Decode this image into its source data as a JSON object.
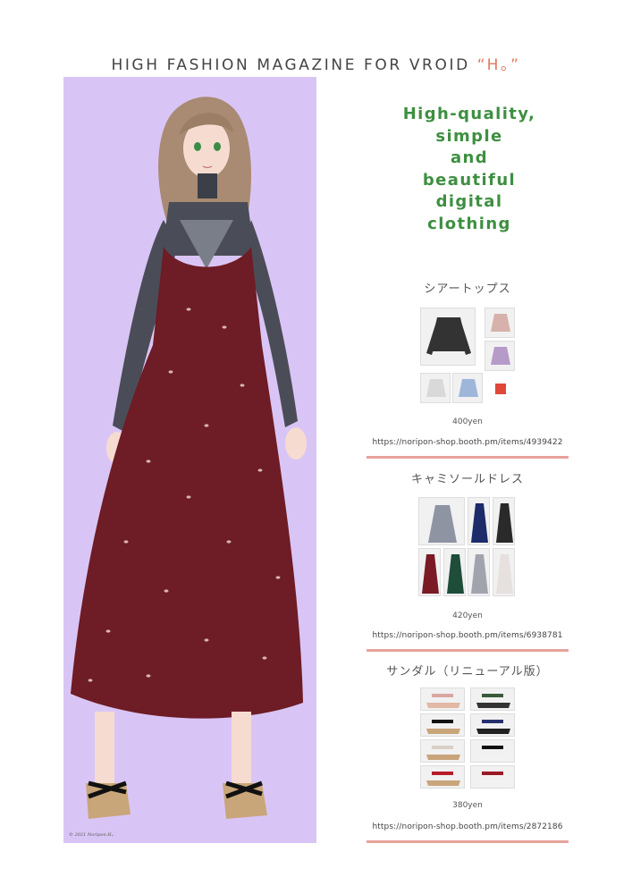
{
  "masthead": {
    "title": "HIGH FASHION MAGAZINE FOR VROID",
    "brand": "“H。”"
  },
  "hero": {
    "copyright": "© 2021 Noripon.H。"
  },
  "tagline": {
    "lines": [
      "High-quality,",
      "simple",
      "and",
      "beautiful",
      "digital",
      "clothing"
    ]
  },
  "products": [
    {
      "title": "シアートップス",
      "price": "400yen",
      "url": "https://noripon-shop.booth.pm/items/4939422"
    },
    {
      "title": "キャミソールドレス",
      "price": "420yen",
      "url": "https://noripon-shop.booth.pm/items/6938781"
    },
    {
      "title": "サンダル（リニューアル版）",
      "price": "380yen",
      "url": "https://noripon-shop.booth.pm/items/2872186"
    }
  ],
  "colors": {
    "accent": "#e07a5f",
    "tagline": "#3e8f41",
    "rule": "#e6a29a",
    "hero_bg": "#d9c5f5",
    "dress": "#6e1c25"
  }
}
